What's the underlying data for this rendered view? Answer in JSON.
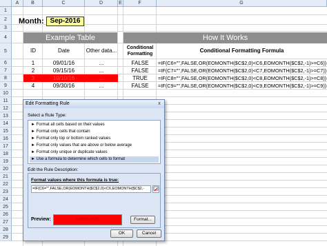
{
  "columns": [
    "A",
    "B",
    "C",
    "D",
    "E",
    "F",
    "G"
  ],
  "rows": [
    "1",
    "2",
    "3",
    "4",
    "5",
    "6",
    "7",
    "8",
    "9",
    "10",
    "11",
    "12",
    "13",
    "14",
    "15",
    "16",
    "17",
    "18",
    "19",
    "20",
    "21",
    "22",
    "23",
    "24",
    "25",
    "26",
    "27",
    "28",
    "29"
  ],
  "month": {
    "label": "Month:",
    "value": "Sep-2016"
  },
  "example_table": {
    "title": "Example Table",
    "headers": [
      "ID",
      "Date",
      "Other data..."
    ],
    "rows": [
      [
        "1",
        "09/01/16",
        "..."
      ],
      [
        "2",
        "09/15/16",
        "..."
      ],
      [
        "3",
        "10/10/16",
        "..."
      ],
      [
        "4",
        "09/30/16",
        "..."
      ]
    ]
  },
  "how_it_works": {
    "title": "How It Works",
    "headers": [
      "Conditional Formatting",
      "Conditional Formatting Formula"
    ],
    "rows": [
      [
        "FALSE",
        "=IF(C6=\"\",FALSE,OR(EOMONTH($C$2,0)<C6,EOMONTH($C$2,-1)>=C6))"
      ],
      [
        "FALSE",
        "=IF(C7=\"\",FALSE,OR(EOMONTH($C$2,0)<C7,EOMONTH($C$2,-1)>=C7))"
      ],
      [
        "TRUE",
        "=IF(C8=\"\",FALSE,OR(EOMONTH($C$2,0)<C8,EOMONTH($C$2,-1)>=C8))"
      ],
      [
        "FALSE",
        "=IF(C9=\"\",FALSE,OR(EOMONTH($C$2,0)<C9,EOMONTH($C$2,-1)>=C9))"
      ]
    ]
  },
  "dialog": {
    "title": "Edit Formatting Rule",
    "close": "x",
    "select_rule_label": "Select a Rule Type:",
    "rule_types": [
      "► Format all cells based on their values",
      "► Format only cells that contain",
      "► Format only top or bottom ranked values",
      "► Format only values that are above or below average",
      "► Format only unique or duplicate values",
      "► Use a formula to determine which cells to format"
    ],
    "selected_rule_index": 5,
    "edit_desc_label": "Edit the Rule Description:",
    "formula_label": "Format values where this formula is true:",
    "formula_value": "=IF(C6=\"\",FALSE,OR(EOMONTH($C$2,0)<C6,EOMONTH($C$2,-",
    "preview_label": "Preview:",
    "preview_text": "AaBbCcYyZz",
    "format_button": "Format...",
    "ok_button": "OK",
    "cancel_button": "Cancel"
  },
  "colors": {
    "header_bar": "#8e8e8e",
    "month_fill": "#ffff99",
    "highlight_red": "#ff0000",
    "column_header_bg": "#e4ecf7"
  }
}
